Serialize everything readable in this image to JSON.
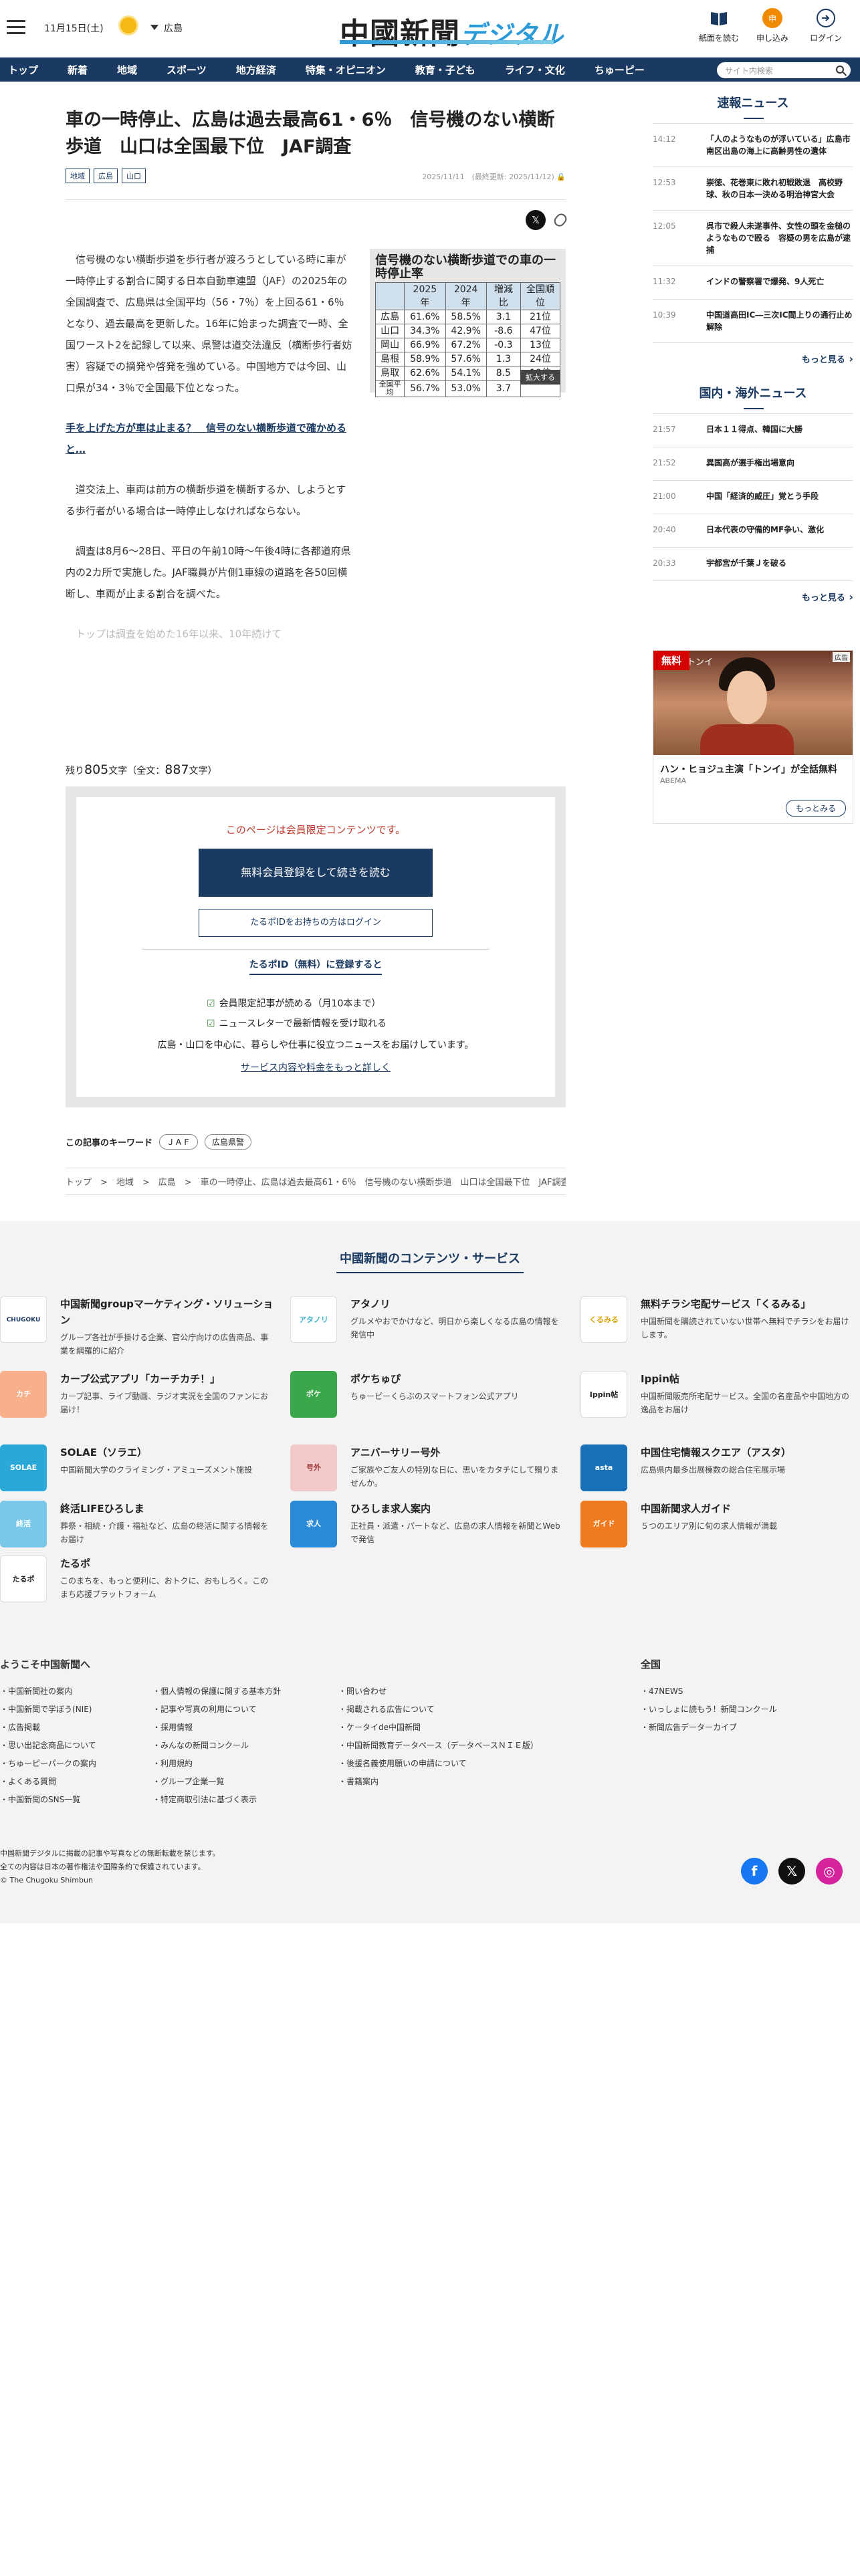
{
  "header": {
    "date": "11月15日(土)",
    "region": "広島",
    "logo_main": "中國新聞",
    "logo_sub": "デジタル",
    "buttons": [
      "紙面を読む",
      "申し込み",
      "ログイン"
    ]
  },
  "nav": {
    "items": [
      "トップ",
      "新着",
      "地域",
      "スポーツ",
      "地方経済",
      "特集・オピニオン",
      "教育・子ども",
      "ライフ・文化",
      "ちゅーピー"
    ],
    "search_placeholder": "サイト内検索"
  },
  "article": {
    "title": "車の一時停止、広島は過去最高61・6％　信号機のない横断歩道　山口は全国最下位　JAF調査",
    "tags": [
      "地域",
      "広島",
      "山口"
    ],
    "dates": "2025/11/11　(最終更新: 2025/11/12)",
    "paragraphs": [
      "信号機のない横断歩道を歩行者が渡ろうとしている時に車が一時停止する割合に関する日本自動車連盟（JAF）の2025年の全国調査で、広島県は全国平均（56・7％）を上回る61・6％となり、過去最高を更新した。16年に始まった調査で一時、全国ワースト2を記録して以来、県警は道交法違反（横断歩行者妨害）容疑での摘発や啓発を強めている。中国地方では今回、山口県が34・3％で全国最下位となった。",
      "道交法上、車両は前方の横断歩道を横断するか、しようとする歩行者がいる場合は一時停止しなければならない。",
      "調査は8月6〜28日、平日の午前10時〜午後4時に各都道府県内の2カ所で実施した。JAF職員が片側1車線の道路を各50回横断し、車両が止まる割合を調べた。"
    ],
    "related": "手を上げた方が車は止まる？　信号のない横断歩道で確かめると…",
    "faded": "トップは調査を始めた16年以来、10年続けて",
    "remaining_label": "残り",
    "remaining": "805",
    "remaining_unit": "文字（全文：",
    "total": "887",
    "total_unit": "文字）"
  },
  "figure": {
    "title": "信号機のない横断歩道での車の一時停止率",
    "headers": [
      "",
      "2025年",
      "2024年",
      "増減比",
      "全国順位"
    ],
    "rows": [
      [
        "広島",
        "61.6%",
        "58.5%",
        "3.1",
        "21位"
      ],
      [
        "山口",
        "34.3%",
        "42.9%",
        "-8.6",
        "47位"
      ],
      [
        "岡山",
        "66.9%",
        "67.2%",
        "-0.3",
        "13位"
      ],
      [
        "島根",
        "58.9%",
        "57.6%",
        "1.3",
        "24位"
      ],
      [
        "鳥取",
        "62.6%",
        "54.1%",
        "8.5",
        "19位"
      ],
      [
        "全国平均",
        "56.7%",
        "53.0%",
        "3.7",
        ""
      ]
    ],
    "zoom": "拡大する"
  },
  "paywall": {
    "message": "このページは会員限定コンテンツです。",
    "register": "無料会員登録をして続きを読む",
    "login": "たるポIDをお持ちの方はログイン",
    "subtitle": "たるポID（無料）に登録すると",
    "benefits": [
      "会員限定記事が読める（月10本まで）",
      "ニュースレターで最新情報を受け取れる"
    ],
    "desc": "広島・山口を中心に、暮らしや仕事に役立つニュースをお届けしています。",
    "more": "サービス内容や料金をもっと詳しく"
  },
  "keywords": {
    "label": "この記事のキーワード",
    "items": [
      "ＪＡＦ",
      "広島県警"
    ]
  },
  "breadcrumb": "トップ　>　地域　>　広島　>　車の一時停止、広島は過去最高61・6％　信号機のない横断歩道　山口は全国最下位　JAF調査",
  "sidebar": {
    "sokuho_title": "速報ニュース",
    "sokuho": [
      [
        "14:12",
        "「人のようなものが浮いている」広島市南区出島の海上に高齢男性の遺体"
      ],
      [
        "12:53",
        "崇徳、花巻東に敗れ初戦敗退　高校野球、秋の日本一決める明治神宮大会"
      ],
      [
        "12:05",
        "呉市で殺人未遂事件、女性の頭を金槌のようなもので殴る　容疑の男を広島が逮捕"
      ],
      [
        "11:32",
        "インドの警察署で爆発、9人死亡"
      ],
      [
        "10:39",
        "中国道高田IC―三次IC間上りの通行止め解除"
      ]
    ],
    "world_title": "国内・海外ニュース",
    "world": [
      [
        "21:57",
        "日本１１得点、韓国に大勝"
      ],
      [
        "21:52",
        "異国高が選手権出場意向"
      ],
      [
        "21:00",
        "中国「経済的威圧」覚とう手段"
      ],
      [
        "20:40",
        "日本代表の守備的MF争い、激化"
      ],
      [
        "20:33",
        "宇都宮が千葉Ｊを破る"
      ]
    ],
    "more": "もっと見る"
  },
  "ad": {
    "badge": "無料",
    "show": "トンイ",
    "label": "広告",
    "title": "ハン・ヒョジュ主演「トンイ」が全話無料",
    "source": "ABEMA",
    "button": "もっとみる"
  },
  "services": {
    "title": "中國新聞のコンテンツ・サービス",
    "items": [
      {
        "name": "中国新聞groupマーケティング・ソリューション",
        "desc": "グループ各社が手掛ける企業、官公庁向けの広告商品、事業を網羅的に紹介"
      },
      {
        "name": "アタノリ",
        "desc": "グルメやおでかけなど、明日から楽しくなる広島の情報を発信中"
      },
      {
        "name": "無料チラシ宅配サービス「くるみる」",
        "desc": "中国新聞を購読されていない世帯へ無料でチラシをお届けします。"
      },
      {
        "name": "カープ公式アプリ「カーチカチ！」",
        "desc": "カープ記事、ライブ動画、ラジオ実況を全国のファンにお届け！"
      },
      {
        "name": "ポケちゅぴ",
        "desc": "ちゅーピーくらぶのスマートフォン公式アプリ"
      },
      {
        "name": "Ippin帖",
        "desc": "中国新聞販売所宅配サービス。全国の名産品や中国地方の逸品をお届け"
      },
      {
        "name": "SOLAE（ソラエ）",
        "desc": "中国新聞大学のクライミング・アミューズメント施設"
      },
      {
        "name": "アニバーサリー号外",
        "desc": "ご家族やご友人の特別な日に、思いをカタチにして贈りませんか。"
      },
      {
        "name": "中国住宅情報スクエア（アスタ）",
        "desc": "広島県内最多出展棟数の総合住宅展示場"
      },
      {
        "name": "終活LIFEひろしま",
        "desc": "葬祭・相続・介護・福祉など、広島の終活に関する情報をお届け"
      },
      {
        "name": "ひろしま求人案内",
        "desc": "正社員・派遣・パートなど、広島の求人情報を新聞とWebで発信"
      },
      {
        "name": "中国新聞求人ガイド",
        "desc": "５つのエリア別に旬の求人情報が満載"
      },
      {
        "name": "たるポ",
        "desc": "このまちを、もっと便利に、おトクに、おもしろく。このまち応援プラットフォーム"
      }
    ]
  },
  "footer_links": {
    "welcome": "ようこそ中国新聞へ",
    "zenkoku": "全国",
    "col1": [
      "中国新聞社の案内",
      "中国新聞で学ぼう(NIE)",
      "広告掲載",
      "思い出記念商品について",
      "ちゅーピーパークの案内",
      "よくある質問",
      "中国新聞のSNS一覧"
    ],
    "col2": [
      "個人情報の保護に関する基本方針",
      "記事や写真の利用について",
      "採用情報",
      "みんなの新聞コンクール",
      "利用規約",
      "グループ企業一覧",
      "特定商取引法に基づく表示"
    ],
    "col3": [
      "問い合わせ",
      "掲載される広告について",
      "ケータイde中国新聞",
      "中国新聞教育データベース（データベースＮＩＥ版）",
      "後援名義使用願いの申請について",
      "書籍案内"
    ],
    "col4": [
      "47NEWS",
      "いっしょに読もう！新聞コンクール",
      "新聞広告データーカイブ"
    ]
  },
  "copyright": [
    "中国新聞デジタルに掲載の記事や写真などの無断転載を禁じます。",
    "全ての内容は日本の著作権法や国際条約で保護されています。",
    "© The Chugoku Shimbun"
  ]
}
